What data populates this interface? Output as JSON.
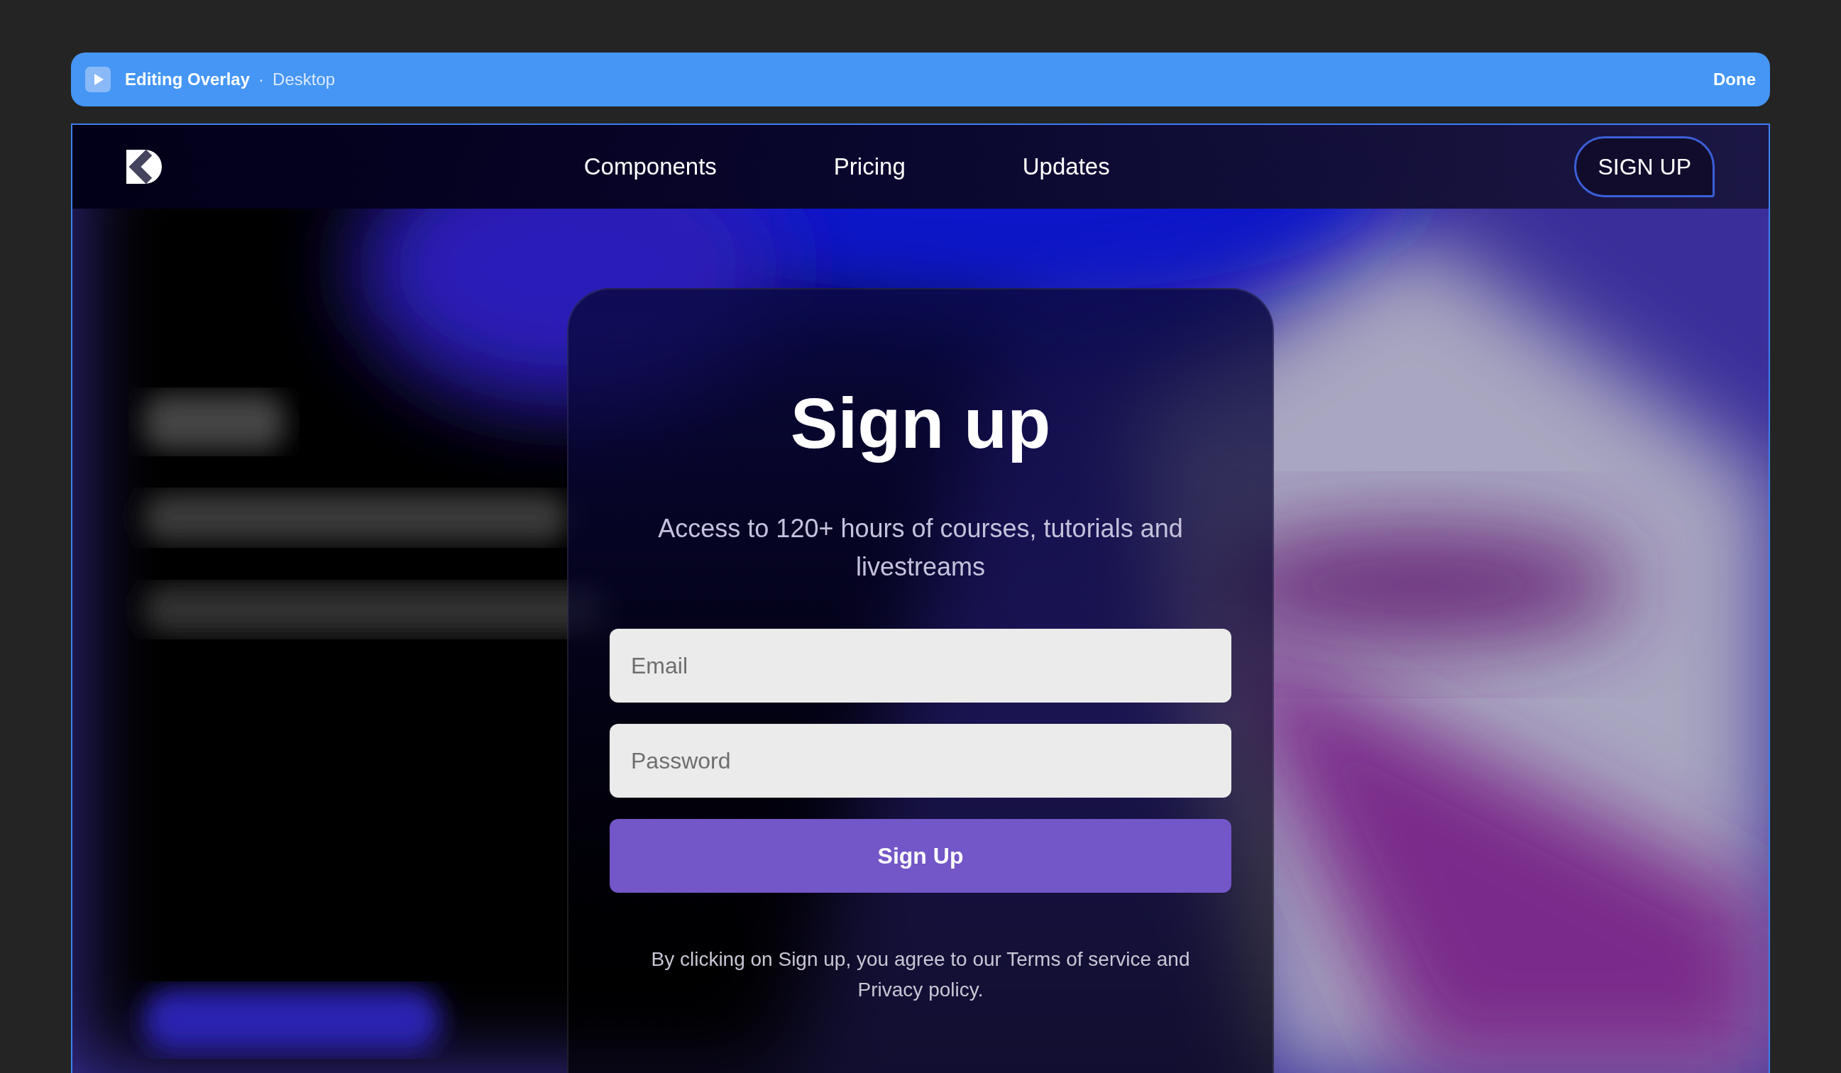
{
  "editor_bar": {
    "title": "Editing Overlay",
    "separator": "·",
    "device": "Desktop",
    "done": "Done"
  },
  "nav": {
    "links": [
      "Components",
      "Pricing",
      "Updates"
    ],
    "cta": "SIGN UP"
  },
  "card": {
    "title": "Sign up",
    "subtitle": "Access to 120+ hours of courses, tutorials and livestreams",
    "fields": [
      {
        "placeholder": "Email"
      },
      {
        "placeholder": "Password"
      }
    ],
    "button": "Sign Up",
    "legal": "By clicking on Sign up, you agree to our Terms of service and Privacy policy."
  }
}
